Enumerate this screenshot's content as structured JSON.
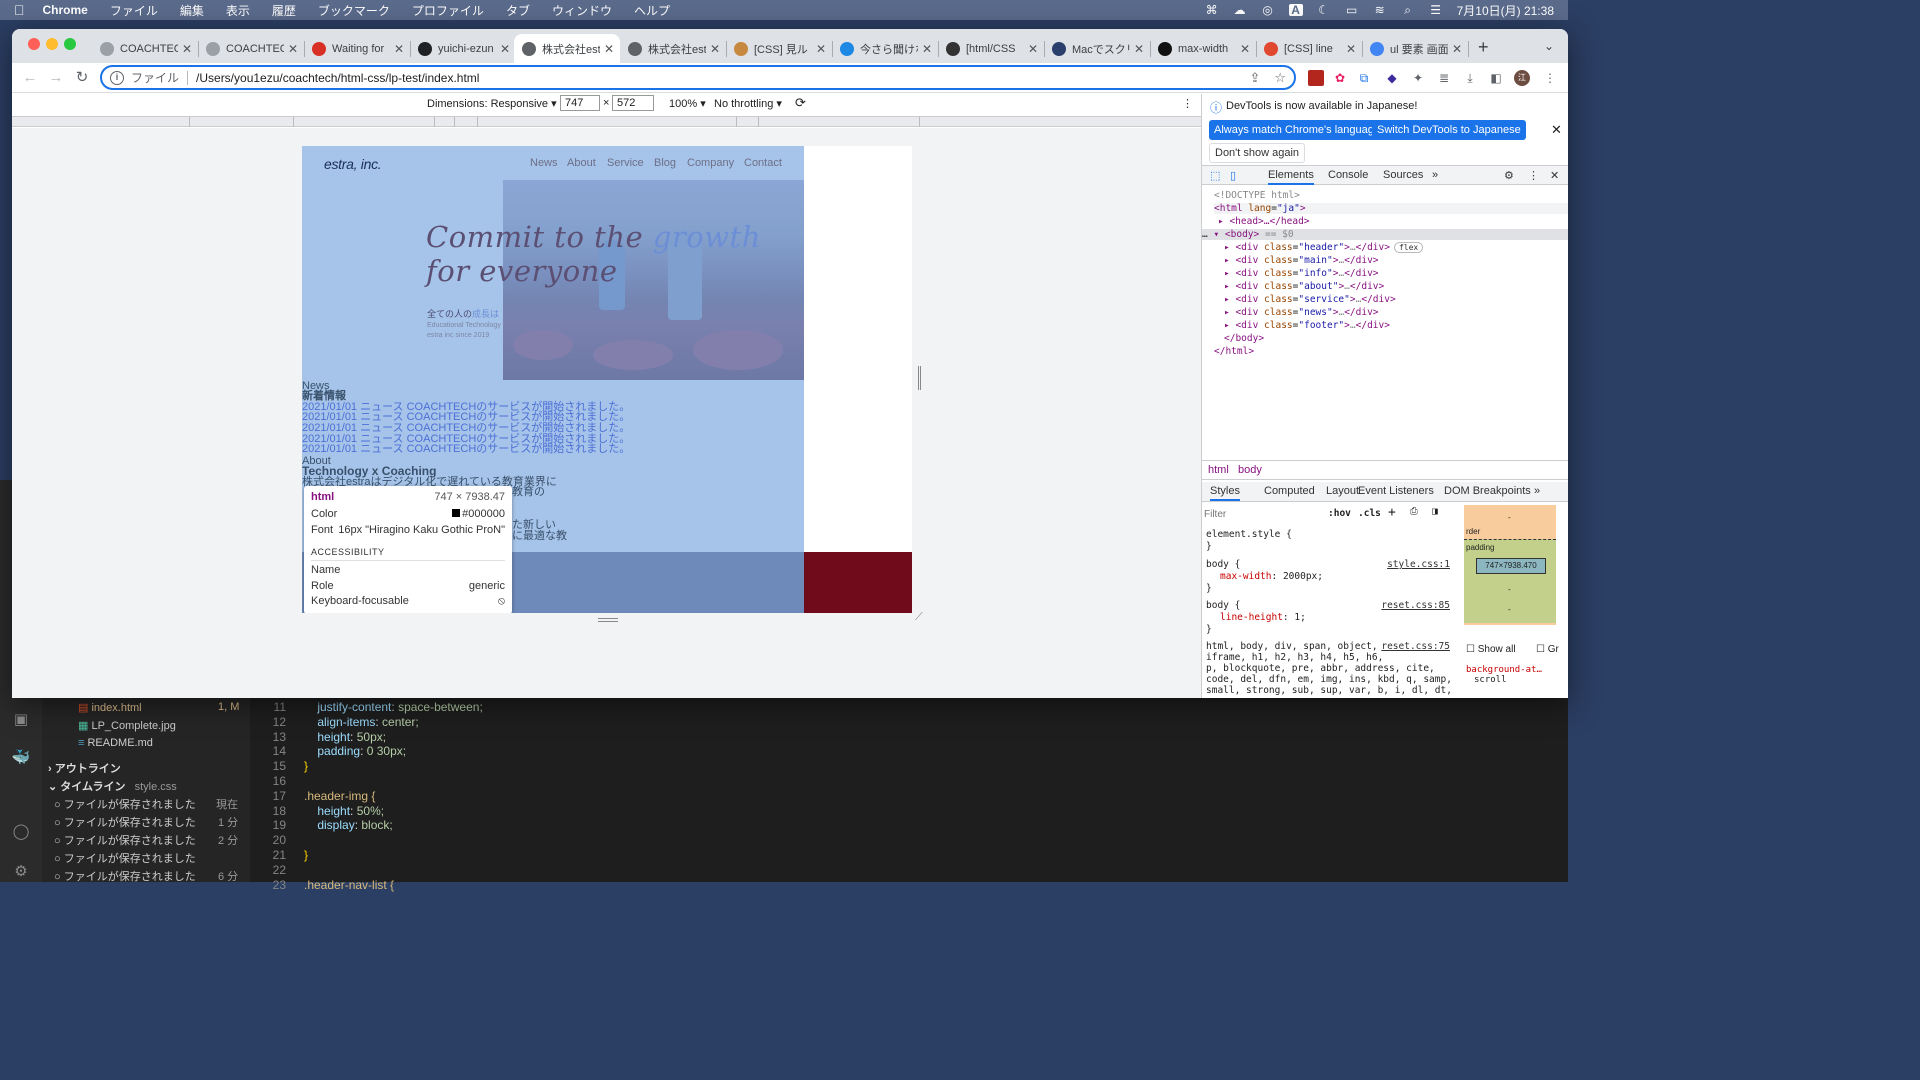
{
  "menubar": {
    "apple": "",
    "app": "Chrome",
    "items": [
      "ファイル",
      "編集",
      "表示",
      "履歴",
      "ブックマーク",
      "プロファイル",
      "タブ",
      "ウィンドウ",
      "ヘルプ"
    ],
    "clock": "7月10日(月) 21:38"
  },
  "tabs": [
    {
      "title": "COACHTEC",
      "favicon": "loading-icon",
      "color": "#9aa0a6"
    },
    {
      "title": "COACHTEC",
      "favicon": "loading-icon",
      "color": "#9aa0a6"
    },
    {
      "title": "Waiting for",
      "favicon": "grid-icon",
      "color": "#d93025"
    },
    {
      "title": "yuichi-ezun",
      "favicon": "github-icon",
      "color": "#202124"
    },
    {
      "title": "株式会社estr",
      "favicon": "globe-icon",
      "color": "#5f6368",
      "active": true
    },
    {
      "title": "株式会社estr",
      "favicon": "globe-icon",
      "color": "#5f6368"
    },
    {
      "title": "[CSS] 見ル",
      "favicon": "dog-icon",
      "color": "#c6893f"
    },
    {
      "title": "今さら聞けな",
      "favicon": "bookmark-icon",
      "color": "#1e88e5"
    },
    {
      "title": "[html/CSS",
      "favicon": "avatar-icon",
      "color": "#333"
    },
    {
      "title": "Macでスクリ",
      "favicon": "m-icon",
      "color": "#2a3f6b"
    },
    {
      "title": "max-width",
      "favicon": "mdn-icon",
      "color": "#111"
    },
    {
      "title": "[CSS] line",
      "favicon": "qiita-icon",
      "color": "#e0482f"
    },
    {
      "title": "ul 要素 画面",
      "favicon": "google-icon",
      "color": "#4285f4"
    }
  ],
  "toolbar": {
    "scheme_label": "ファイル",
    "url": "/Users/you1ezu/coachtech/html-css/lp-test/index.html"
  },
  "devbar": {
    "dimensions": "Dimensions: Responsive ▾",
    "width": "747",
    "times": "×",
    "height": "572",
    "zoom": "100% ▾",
    "throttle": "No throttling ▾"
  },
  "page": {
    "logo": "estra, inc.",
    "nav": [
      "News",
      "About",
      "Service",
      "Blog",
      "Company",
      "Contact"
    ],
    "hero_line1a": "Commit to the ",
    "hero_line1b": "growth",
    "hero_line2": "for everyone",
    "tagline_a": "全ての人の",
    "tagline_b": "成長は",
    "small1": "Educational Technology",
    "small2": "estra inc since 2019",
    "news_label": "News",
    "news_title": "新着情報",
    "news_items": [
      "2021/01/01 ニュース COACHTECHのサービスが開始されました。",
      "2021/01/01 ニュース COACHTECHのサービスが開始されました。",
      "2021/01/01 ニュース COACHTECHのサービスが開始されました。",
      "2021/01/01 ニュース COACHTECHのサービスが開始されました。",
      "2021/01/01 ニュース COACHTECHのサービスが開始されました。"
    ],
    "about_label": "About",
    "about_title": "Technology x Coaching",
    "about_text1": "株式会社estraはデジタル化で遅れている教育業界に",
    "about_text2": "教育の",
    "about_text3": "た新しい",
    "about_text4": "に最適な教"
  },
  "tooltip": {
    "tag": "html",
    "size": "747 × 7938.47",
    "color_label": "Color",
    "color_value": "#000000",
    "font_label": "Font",
    "font_value": "16px \"Hiragino Kaku Gothic ProN\"",
    "section": "ACCESSIBILITY",
    "name_label": "Name",
    "role_label": "Role",
    "role_value": "generic",
    "kf_label": "Keyboard-focusable"
  },
  "devtools": {
    "notice": "DevTools is now available in Japanese!",
    "btn_match": "Always match Chrome's language",
    "btn_switch": "Switch DevTools to Japanese",
    "btn_dont": "Don't show again",
    "tabs": [
      "Elements",
      "Console",
      "Sources",
      "»"
    ],
    "dom": {
      "doctype": "<!DOCTYPE html>",
      "html_open": "<html ",
      "html_attr": "lang",
      "html_val": "\"ja\"",
      "head": "<head>…</head>",
      "body": "<body>",
      "body_sel": "== $0",
      "divs": [
        {
          "cls": "\"header\"",
          "badge": "flex"
        },
        {
          "cls": "\"main\""
        },
        {
          "cls": "\"info\""
        },
        {
          "cls": "\"about\""
        },
        {
          "cls": "\"service\""
        },
        {
          "cls": "\"news\""
        },
        {
          "cls": "\"footer\""
        }
      ],
      "body_close": "</body>",
      "html_close": "</html>"
    },
    "breadcrumb": [
      "html",
      "body"
    ],
    "style_tabs": [
      "Styles",
      "Computed",
      "Layout",
      "Event Listeners",
      "DOM Breakpoints",
      "»"
    ],
    "filter_placeholder": "Filter",
    "hov": ":hov",
    "cls": ".cls",
    "rules": [
      {
        "sel": "element.style {",
        "close": "}"
      },
      {
        "sel": "body {",
        "src": "style.css:1",
        "prop": "max-width",
        "val": "2000px;",
        "close": "}"
      },
      {
        "sel": "body {",
        "src": "reset.css:85",
        "prop": "line-height",
        "val": "1;",
        "close": "}"
      },
      {
        "sel": "html, body, div, span, object,",
        "src": "reset.css:75",
        "more": [
          "iframe, h1, h2, h3, h4, h5, h6,",
          "p, blockquote, pre, abbr, address, cite,",
          "code, del, dfn, em, img, ins, kbd, q, samp,",
          "small, strong, sub, sup, var, b, i, dl, dt,",
          "dd, ol, ul, li, fieldset, form, label,"
        ]
      }
    ],
    "boxmodel": {
      "margin": "-",
      "border": "rder",
      "padding": "padding",
      "content": "747×7938.470",
      "dash": "-"
    },
    "show_all": "Show all",
    "show_gr": "Gr",
    "bg_prop": "background-at…",
    "bg_val": "scroll"
  },
  "editor": {
    "files": [
      {
        "name": "index.html",
        "status": "1, M"
      },
      {
        "name": "LP_Complete.jpg"
      },
      {
        "name": "README.md"
      }
    ],
    "outline": "アウトライン",
    "timeline": "タイムライン",
    "timeline_file": "style.css",
    "timeline_items": [
      {
        "t": "ファイルが保存されました",
        "w": "現在"
      },
      {
        "t": "ファイルが保存されました",
        "w": "1 分"
      },
      {
        "t": "ファイルが保存されました",
        "w": "2 分"
      },
      {
        "t": "ファイルが保存されました",
        "w": ""
      },
      {
        "t": "ファイルが保存されました",
        "w": "6 分"
      }
    ],
    "lines": [
      {
        "n": "11",
        "p": "justify-content",
        "v": "space-between;"
      },
      {
        "n": "12",
        "p": "align-items",
        "v": "center;"
      },
      {
        "n": "13",
        "p": "height",
        "v": "50px;"
      },
      {
        "n": "14",
        "p": "padding",
        "v": "0 30px;"
      },
      {
        "n": "15",
        "raw": "}"
      },
      {
        "n": "16",
        "raw": ""
      },
      {
        "n": "17",
        "sel": ".header-img {"
      },
      {
        "n": "18",
        "p": "height",
        "v": "50%;"
      },
      {
        "n": "19",
        "p": "display",
        "v": "block;"
      },
      {
        "n": "20",
        "raw": ""
      },
      {
        "n": "21",
        "raw": "}"
      },
      {
        "n": "22",
        "raw": ""
      },
      {
        "n": "23",
        "sel": ".header-nav-list {"
      }
    ]
  }
}
